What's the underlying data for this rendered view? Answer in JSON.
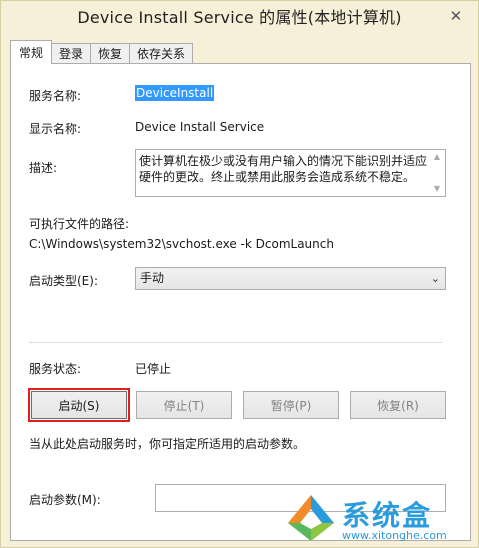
{
  "window": {
    "title": "Device Install Service 的属性(本地计算机)",
    "close_glyph": "✕"
  },
  "tabs": [
    {
      "label": "常规"
    },
    {
      "label": "登录"
    },
    {
      "label": "恢复"
    },
    {
      "label": "依存关系"
    }
  ],
  "general": {
    "service_name_label": "服务名称:",
    "service_name_value": "DeviceInstall",
    "display_name_label": "显示名称:",
    "display_name_value": "Device Install Service",
    "description_label": "描述:",
    "description_value": "使计算机在极少或没有用户输入的情况下能识别并适应硬件的更改。终止或禁用此服务会造成系统不稳定。",
    "exec_path_label": "可执行文件的路径:",
    "exec_path_value": "C:\\Windows\\system32\\svchost.exe -k DcomLaunch",
    "startup_type_label": "启动类型(E):",
    "startup_type_value": "手动",
    "service_status_label": "服务状态:",
    "service_status_value": "已停止",
    "buttons": {
      "start": "启动(S)",
      "stop": "停止(T)",
      "pause": "暂停(P)",
      "resume": "恢复(R)"
    },
    "hint_text": "当从此处启动服务时，你可指定所适用的启动参数。",
    "start_params_label": "启动参数(M):",
    "start_params_value": ""
  },
  "watermark": {
    "text": "系统盒",
    "url": "www.xitonghe.com"
  },
  "colors": {
    "accent_focus": "#e02020",
    "selection": "#3399ff",
    "brand": "#2a9bdc"
  },
  "icons": {
    "close": "close-icon",
    "dropdown": "chevron-down-icon",
    "logo": "xitonghe-logo-icon"
  }
}
